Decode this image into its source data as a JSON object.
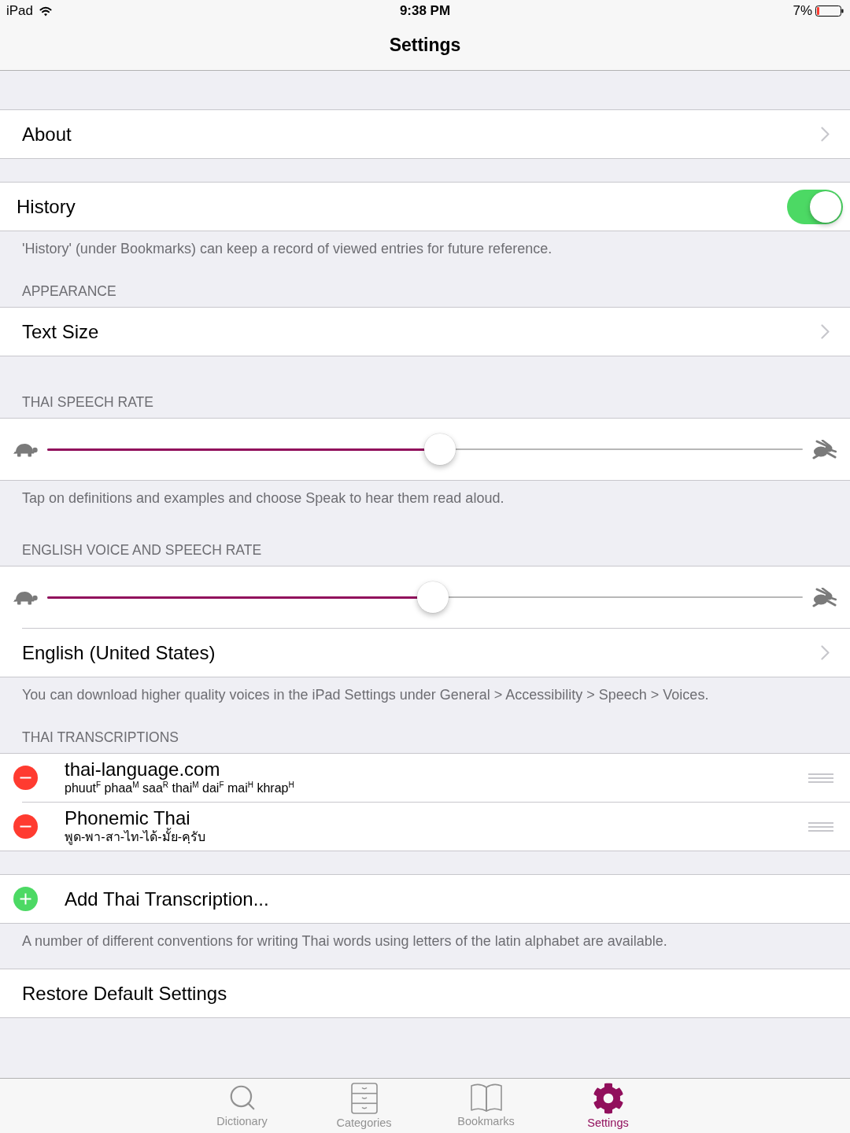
{
  "status_bar": {
    "device": "iPad",
    "time": "9:38 PM",
    "battery": "7%"
  },
  "nav_bar": {
    "title": "Settings"
  },
  "sections": [
    {
      "rows": [
        {
          "kind": "link",
          "label": "About"
        }
      ]
    },
    {
      "rows": [
        {
          "kind": "toggle",
          "label": "History",
          "on": true
        }
      ],
      "footer": "'History' (under Bookmarks) can keep a record of viewed entries for future reference."
    },
    {
      "header": "APPEARANCE",
      "rows": [
        {
          "kind": "link",
          "label": "Text Size"
        }
      ]
    },
    {
      "header": "THAI SPEECH RATE",
      "rows": [
        {
          "kind": "slider",
          "level": 0.52
        }
      ],
      "footer": "Tap on definitions and examples and choose Speak to hear them read aloud."
    },
    {
      "header": "ENGLISH VOICE AND SPEECH RATE",
      "rows": [
        {
          "kind": "slider",
          "level": 0.51
        },
        {
          "kind": "link",
          "label": "English (United States)"
        }
      ],
      "footer": "You can download higher quality voices in the iPad Settings under General > Accessibility > Speech > Voices."
    },
    {
      "header": "THAI TRANSCRIPTIONS",
      "rows": [
        {
          "kind": "removable",
          "title": "thai-language.com",
          "subtitle": "phuut$^{F}$ phaa$^{M}$ saa$^{R}$ thai$^{M}$ dai$^{F}$ mai$^{H}$ khrap$^{H}$"
        },
        {
          "kind": "removable",
          "title": "Phonemic Thai",
          "subtitle": "พูด-พา-สา-ไท-ได้-มั้ย-คฺรับ"
        }
      ]
    },
    {
      "rows": [
        {
          "kind": "add",
          "label": "Add Thai Transcription..."
        }
      ],
      "footer": "A number of different conventions for writing Thai words using letters of the latin alphabet are available."
    },
    {
      "rows": [
        {
          "kind": "plain",
          "label": "Restore Default Settings"
        }
      ]
    }
  ],
  "tab_bar": [
    {
      "label": "Dictionary",
      "selected": false
    },
    {
      "label": "Categories",
      "selected": false
    },
    {
      "label": "Bookmarks",
      "selected": false
    },
    {
      "label": "Settings",
      "selected": true
    }
  ]
}
